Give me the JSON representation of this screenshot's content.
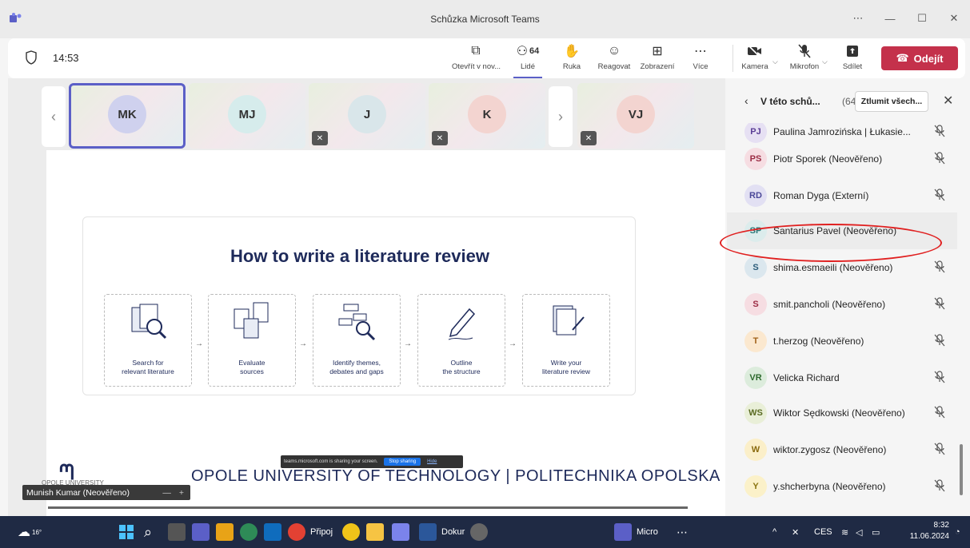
{
  "window": {
    "title": "Schůzka Microsoft Teams",
    "controls": [
      "⋯",
      "—",
      "☐",
      "✕"
    ]
  },
  "toolbar": {
    "timer": "14:53",
    "items": [
      {
        "label": "Otevřít v nov...",
        "icon": "open-window-icon"
      },
      {
        "label": "Lidé",
        "icon": "people-icon",
        "badge": "64"
      },
      {
        "label": "Ruka",
        "icon": "raise-hand-icon"
      },
      {
        "label": "Reagovat",
        "icon": "react-icon"
      },
      {
        "label": "Zobrazení",
        "icon": "view-icon"
      },
      {
        "label": "Více",
        "icon": "more-icon"
      }
    ],
    "devices": [
      {
        "label": "Kamera",
        "icon": "camera-off-icon"
      },
      {
        "label": "Mikrofon",
        "icon": "mic-off-icon"
      },
      {
        "label": "Sdílet",
        "icon": "share-icon"
      }
    ],
    "leave_label": "Odejít",
    "leave_color": "#c4314b"
  },
  "thumbnails": [
    {
      "initials": "MK",
      "color": "#cfd1ee",
      "active": true,
      "muted": false
    },
    {
      "initials": "MJ",
      "color": "#d6ecec",
      "active": false,
      "muted": false
    },
    {
      "initials": "J",
      "color": "#d9e6ea",
      "active": false,
      "muted": true
    },
    {
      "initials": "K",
      "color": "#f3d4d0",
      "active": false,
      "muted": true
    },
    {
      "initials": "VJ",
      "color": "#f3d4d0",
      "active": false,
      "muted": true
    }
  ],
  "slide": {
    "title": "How to write a literature review",
    "steps": [
      {
        "line1": "Search for",
        "line2": "relevant literature"
      },
      {
        "line1": "Evaluate",
        "line2": "sources"
      },
      {
        "line1": "Identify themes,",
        "line2": "debates and gaps"
      },
      {
        "line1": "Outline",
        "line2": "the structure"
      },
      {
        "line1": "Write your",
        "line2": "literature review"
      }
    ],
    "university_small": "OPOLE UNIVERSITY",
    "banner": "OPOLE UNIVERSITY OF TECHNOLOGY | POLITECHNIKA OPOLSKA"
  },
  "sharing_bar": {
    "text": "teams.microsoft.com is sharing your screen.",
    "stop": "Stop sharing",
    "hide": "Hide"
  },
  "presenter_name": "Munish Kumar (Neověřeno)",
  "panel": {
    "title": "V této schů...",
    "count": "(64)",
    "mute_all": "Ztlumit všech...",
    "participants": [
      {
        "initials": "PJ",
        "name": "Paulina Jamrozińska | Łukasie...",
        "bg": "#e6e0f3",
        "fg": "#5b3e96"
      },
      {
        "initials": "PS",
        "name": "Piotr Sporek (Neověřeno)",
        "bg": "#f6dde2",
        "fg": "#9b2c44"
      },
      {
        "initials": "RD",
        "name": "Roman Dyga (Externí)",
        "bg": "#e2e0f3",
        "fg": "#4b4898"
      },
      {
        "initials": "SP",
        "name": "Santarius Pavel (Neověřeno)",
        "bg": "#dcecec",
        "fg": "#2b7a7a"
      },
      {
        "initials": "S",
        "name": "shima.esmaeili (Neověřeno)",
        "bg": "#dbe7ee",
        "fg": "#2c5c7a"
      },
      {
        "initials": "S",
        "name": "smit.pancholi (Neověřeno)",
        "bg": "#f6dde2",
        "fg": "#9b2c44"
      },
      {
        "initials": "T",
        "name": "t.herzog (Neověřeno)",
        "bg": "#fbe8cf",
        "fg": "#a0621a"
      },
      {
        "initials": "VR",
        "name": "Velicka Richard",
        "bg": "#dcecdc",
        "fg": "#2f6b2f"
      },
      {
        "initials": "WS",
        "name": "Wiktor Sędkowski (Neověřeno)",
        "bg": "#e9efd8",
        "fg": "#5a6b22"
      },
      {
        "initials": "W",
        "name": "wiktor.zygosz (Neověřeno)",
        "bg": "#fbefc9",
        "fg": "#8a6a0e"
      },
      {
        "initials": "Y",
        "name": "y.shcherbyna (Neověřeno)",
        "bg": "#fbf1c9",
        "fg": "#8a7410"
      }
    ]
  },
  "taskbar": {
    "weather": "16°",
    "apps": [
      "Připoj",
      "Dokur",
      "Micro"
    ],
    "lang": "CES",
    "time": "8:32",
    "date": "11.06.2024"
  }
}
